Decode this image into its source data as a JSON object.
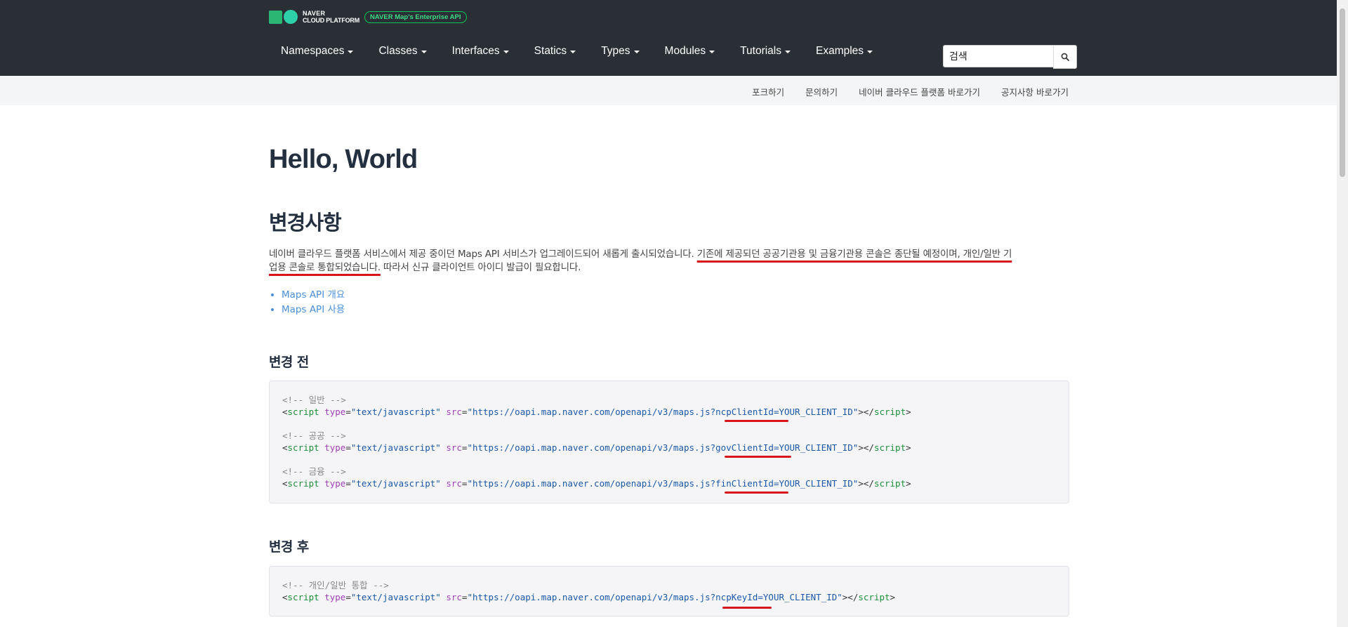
{
  "header": {
    "logo_line1": "NAVER",
    "logo_line2": "CLOUD PLATFORM",
    "badge": "NAVER Map's Enterprise API",
    "nav": [
      "Namespaces",
      "Classes",
      "Interfaces",
      "Statics",
      "Types",
      "Modules",
      "Tutorials",
      "Examples"
    ],
    "search_value": "검색"
  },
  "subnav": {
    "links": [
      "포크하기",
      "문의하기",
      "네이버 클라우드 플랫폼 바로가기",
      "공지사항 바로가기"
    ]
  },
  "content": {
    "title": "Hello, World",
    "section_title": "변경사항",
    "intro_part1": "네이버 클라우드 플랫폼 서비스에서 제공 중이던 Maps API 서비스가 업그레이드되어 새롭게 출시되었습니다. ",
    "intro_part2a": "기존에 제공되던 공공기관용 및 금융기관용 콘솔은 종단될 예정이며, 개인/일반 기",
    "intro_part2b": "업용 콘솔로 통합되었습니다.",
    "intro_part3": " 따라서 신규 클라이언트 아이디 발급이 필요합니다.",
    "links": [
      "Maps API 개요",
      "Maps API 사용"
    ],
    "before_title": "변경 전",
    "after_title": "변경 후",
    "code": {
      "lt": "<",
      "gt": ">",
      "script_tag": "script",
      "close_open": "</",
      "type_attr": "type",
      "type_val": "\"text/javascript\"",
      "src_attr": "src",
      "url": "\"https://oapi.map.naver.com/openapi/v3/maps.js?",
      "client_val": "YOUR_CLIENT_ID\"",
      "before": [
        {
          "comment": "<!-- 일반 -->",
          "param": "ncpClientId="
        },
        {
          "comment": "<!-- 공공 -->",
          "param": "govClientId="
        },
        {
          "comment": "<!-- 금융 -->",
          "param": "finClientId="
        }
      ],
      "after": [
        {
          "comment": "<!-- 개인/일반 통합 -->",
          "param": "ncpKeyId="
        }
      ]
    }
  },
  "colors": {
    "topbar": "#2a2f36",
    "accent": "#03c75a",
    "underline": "#d6161b",
    "link": "#4a90d9"
  }
}
